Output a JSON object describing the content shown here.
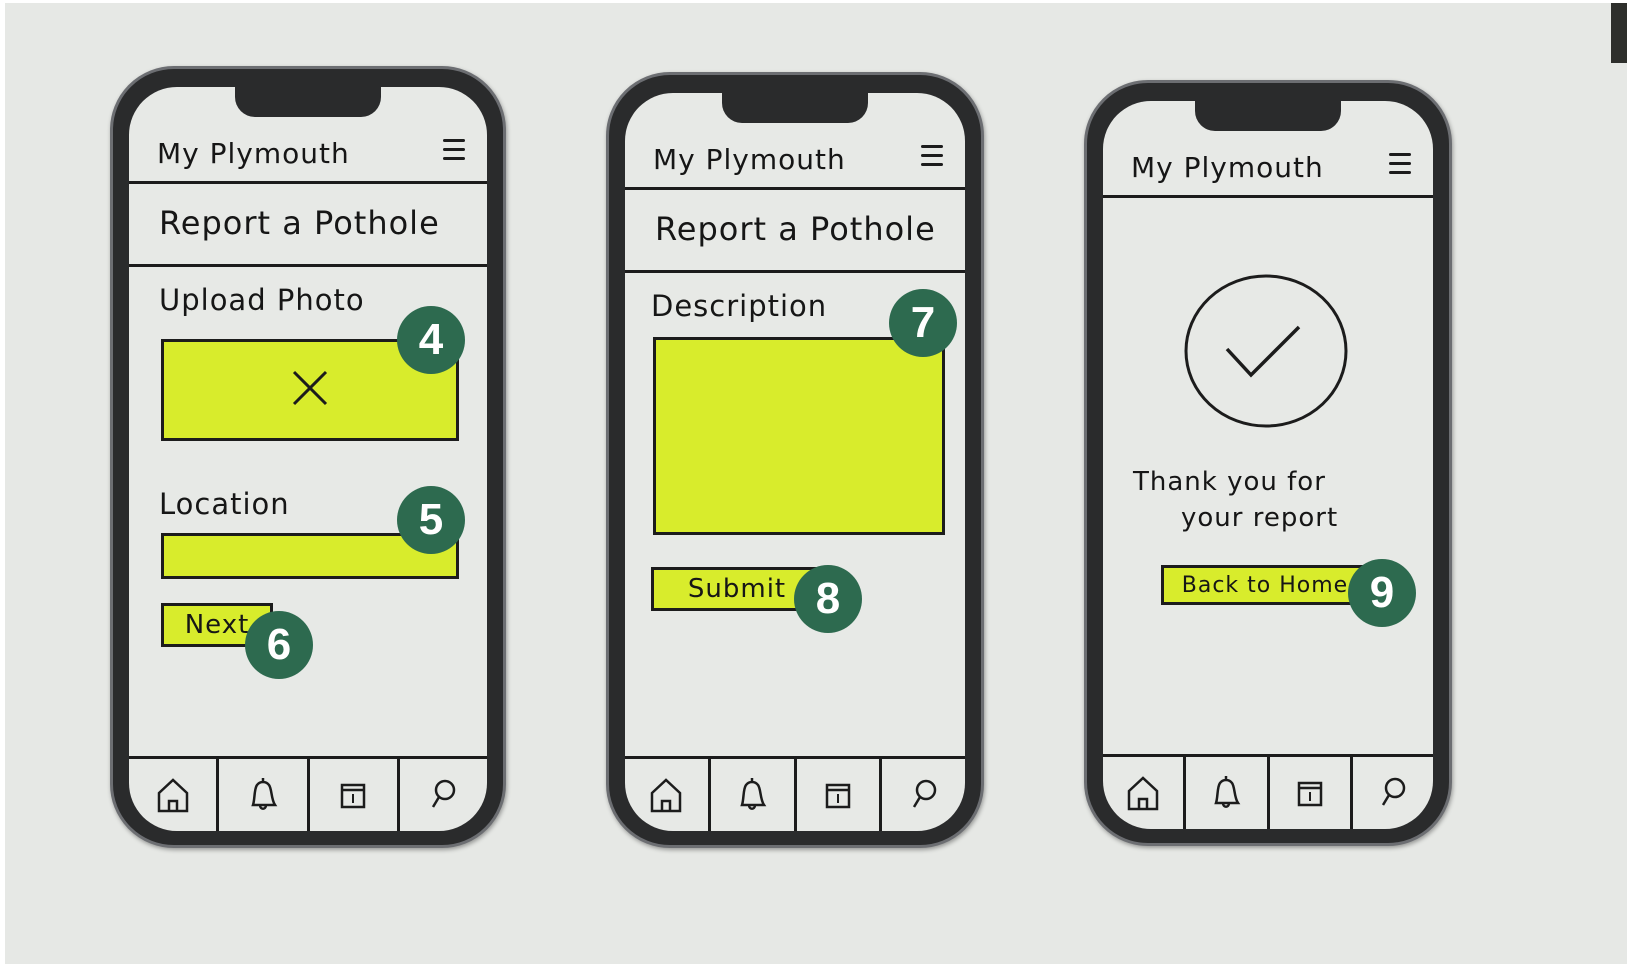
{
  "screens": [
    {
      "app_title": "My Plymouth",
      "page_title": "Report a Pothole",
      "upload_label": "Upload Photo",
      "location_label": "Location",
      "next_label": "Next",
      "badges": [
        "4",
        "5",
        "6"
      ]
    },
    {
      "app_title": "My Plymouth",
      "page_title": "Report a Pothole",
      "description_label": "Description",
      "submit_label": "Submit",
      "badges": [
        "7",
        "8"
      ]
    },
    {
      "app_title": "My Plymouth",
      "thank_you_line1": "Thank you for",
      "thank_you_line2": "your report",
      "back_home_label": "Back to Home",
      "badges": [
        "9"
      ]
    }
  ],
  "tabbar_icons": [
    "home-icon",
    "bell-icon",
    "calendar-icon",
    "search-icon"
  ],
  "colors": {
    "highlight": "#d8ec2c",
    "badge": "#2d6a4f",
    "phone_frame": "#2a2b2c",
    "paper": "#e6e8e5"
  }
}
